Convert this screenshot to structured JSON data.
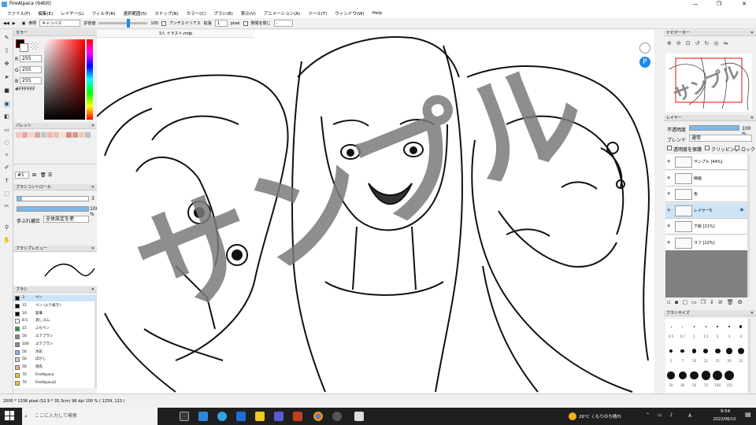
{
  "window": {
    "title": "FireAlpaca (64bit)"
  },
  "menu": [
    "ファイル(F)",
    "編集(E)",
    "レイヤー(L)",
    "フィルタ(R)",
    "選択範囲(S)",
    "スナップ(N)",
    "カラー(C)",
    "ブラシ(B)",
    "表示(V)",
    "アニメーション(A)",
    "ツール(T)",
    "ウィンドウ(W)",
    "Help"
  ],
  "toolbar": {
    "ref_label": "参照",
    "ref_value": "キャンバス",
    "tol_label": "許容値",
    "tol_value": "100",
    "aa_label": "アンチエイリアス",
    "expand_label": "拡張",
    "expand_value": "1",
    "expand_unit": "pixel",
    "gap_label": "隙間を閉じ",
    "gap_value": "-"
  },
  "document": {
    "tab": "3人 イラスト.mdp",
    "watermark": "サンプル"
  },
  "color_panel": {
    "title": "カラー",
    "r_label": "R",
    "r": "255",
    "g_label": "G",
    "g": "255",
    "b_label": "B",
    "b": "255",
    "hex": "#FFFFFF"
  },
  "palette": {
    "title": "パレット",
    "colors": [
      "#f3c7c0",
      "#e8a99c",
      "#f4d3c5",
      "#d9a89a",
      "#c7c7c7",
      "#f1b8a8",
      "#e2c4b3",
      "#f6e0d2",
      "#d58d7a",
      "#c9a090",
      "#eecbb7",
      "#bfbfbf"
    ],
    "page": "#1"
  },
  "brush_control": {
    "title": "ブラシコントロール",
    "size": "3",
    "opacity": "100 %",
    "correction_label": "手ぶれ補正",
    "correction_value": "全体設定を使"
  },
  "brush_preview": {
    "title": "ブラシプレビュー"
  },
  "brushes": {
    "title": "ブラシ",
    "items": [
      {
        "size": "3",
        "name": "ペン",
        "color": "#000000"
      },
      {
        "size": "15",
        "name": "ペン (入り抜き)",
        "color": "#000000"
      },
      {
        "size": "10",
        "name": "鉛筆",
        "color": "#000000"
      },
      {
        "size": "8.5",
        "name": "消しゴム",
        "color": "#ffffff"
      },
      {
        "size": "15",
        "name": "ふちペン",
        "color": "#1fa01f"
      },
      {
        "size": "50",
        "name": "エアブラシ",
        "color": "#888888"
      },
      {
        "size": "100",
        "name": "エアブラシ",
        "color": "#888888"
      },
      {
        "size": "50",
        "name": "水彩",
        "color": "#88aaff"
      },
      {
        "size": "50",
        "name": "ぼかし",
        "color": "#cccccc"
      },
      {
        "size": "50",
        "name": "指先",
        "color": "#eeaaaa"
      },
      {
        "size": "70",
        "name": "FireAlpaca",
        "color": "#f2c21b"
      },
      {
        "size": "70",
        "name": "FireAlpaca2",
        "color": "#f2c21b"
      }
    ]
  },
  "navigator": {
    "title": "ナビゲーター"
  },
  "layers": {
    "title": "レイヤー",
    "opacity_label": "不透明度",
    "opacity_value": "100 %",
    "blend_label": "ブレンド",
    "blend_value": "通常",
    "protect_label": "透明度を保護",
    "clip_label": "クリッピング",
    "lock_label": "ロック",
    "items": [
      {
        "name": "サンプル [44%]"
      },
      {
        "name": "線画"
      },
      {
        "name": "色"
      },
      {
        "name": "レイヤー5"
      },
      {
        "name": "下絵 [21%]"
      },
      {
        "name": "ラフ [22%]"
      }
    ]
  },
  "brush_size": {
    "title": "ブラシサイズ",
    "labels": [
      "0.5",
      "0.7",
      "1",
      "1.5",
      "2",
      "3",
      "4",
      "5",
      "7",
      "10",
      "12",
      "15",
      "20",
      "25",
      "30",
      "40",
      "50",
      "70",
      "100",
      "150"
    ]
  },
  "status": {
    "text": "2000 * 1336 pixel   (52.9 * 35.3cm)   96 dpi   100 %   ( 1259, 123 )"
  },
  "taskbar": {
    "search": "ここに入力して検索",
    "weather": "26°C くもりのち晴れ",
    "time": "9:54",
    "date": "2022/06/10",
    "lang": "A"
  }
}
